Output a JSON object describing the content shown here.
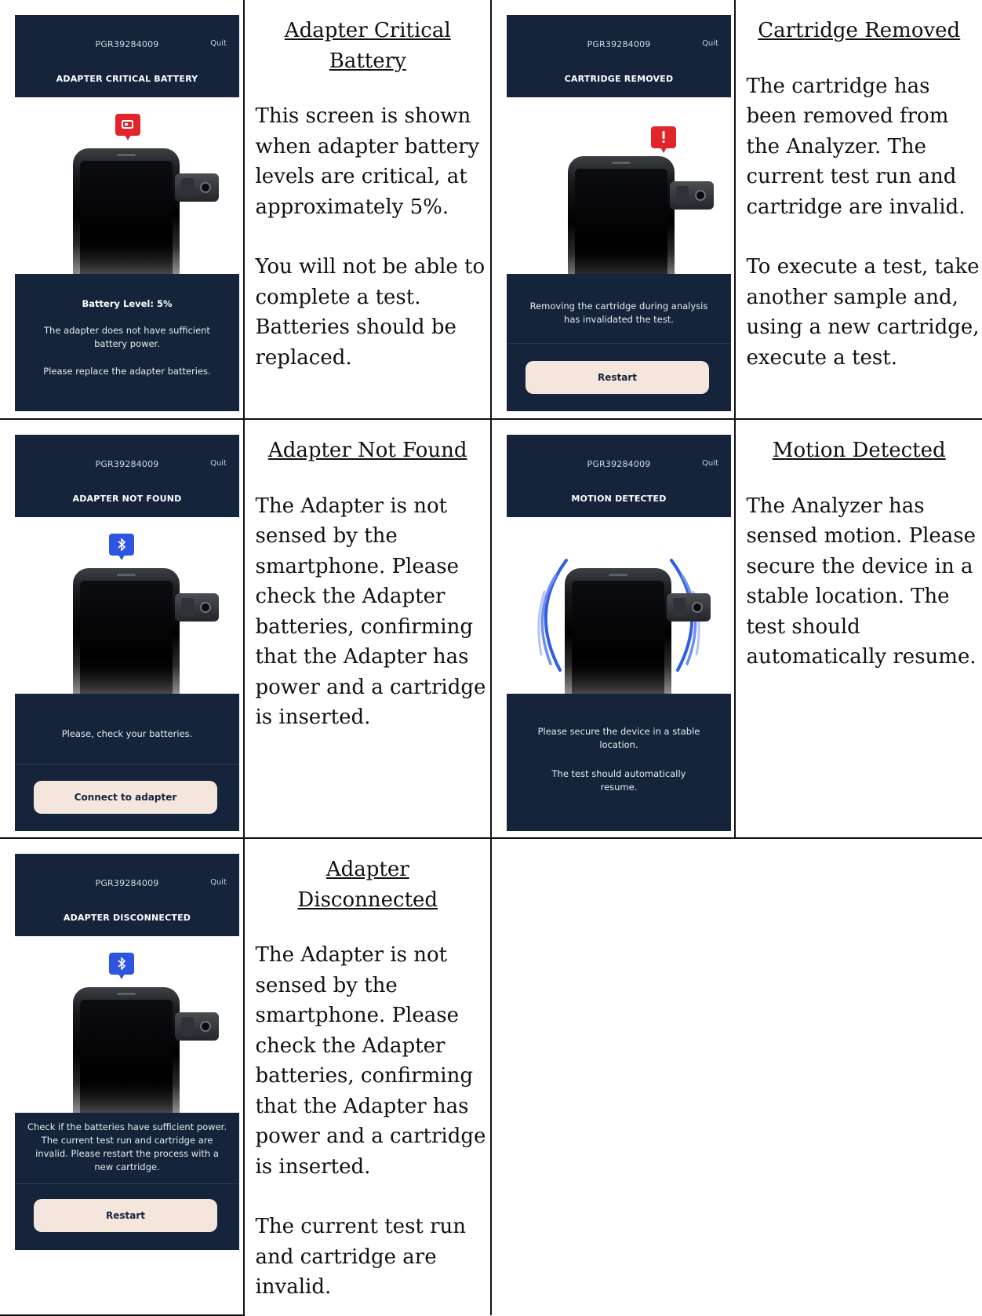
{
  "serial": "PGR39284009",
  "quit_label": "Quit",
  "cells": {
    "critical_battery": {
      "screen_title": "ADAPTER CRITICAL BATTERY",
      "footer_bold": "Battery Level: 5%",
      "footer_line1": "The adapter does not have sufficient battery power.",
      "footer_line2": "Please replace the adapter batteries.",
      "badge_icon": "battery-alert-icon",
      "badge_color": "#e0252d",
      "heading": "Adapter Critical Battery",
      "paragraphs": [
        "This screen is shown when adapter battery levels are critical, at approximately 5%.",
        "You will not be able to complete a test. Batteries should be replaced."
      ]
    },
    "cartridge_removed": {
      "screen_title": "CARTRIDGE REMOVED",
      "footer_line1": "Removing the cartridge during analysis has invalidated the test.",
      "button_label": "Restart",
      "badge_icon": "exclamation-icon",
      "badge_color": "#e0252d",
      "heading": "Cartridge Removed",
      "paragraphs": [
        "The cartridge has been removed from the Analyzer. The current test run and cartridge are invalid.",
        "To execute a test, take another sample and, using a new cartridge, execute a test."
      ]
    },
    "adapter_not_found": {
      "screen_title": "ADAPTER NOT FOUND",
      "footer_line1": "Please, check your batteries.",
      "button_label": "Connect to adapter",
      "badge_icon": "bluetooth-icon",
      "badge_color": "#2e55e0",
      "heading": "Adapter Not Found",
      "paragraphs": [
        "The Adapter is not sensed by the smartphone. Please check the Adapter batteries, confirming that the Adapter has power and a cartridge is inserted."
      ]
    },
    "motion_detected": {
      "screen_title": "MOTION DETECTED",
      "footer_line1": "Please secure the device in a stable location.",
      "footer_line2": "The test should automatically resume.",
      "heading": "Motion Detected",
      "paragraphs": [
        "The Analyzer has sensed motion. Please secure the device in a stable location. The test should automatically resume."
      ]
    },
    "adapter_disconnected": {
      "screen_title": "ADAPTER DISCONNECTED",
      "footer_line1": "Check if the batteries have sufficient power. The current test run and cartridge are invalid. Please restart the process with a new cartridge.",
      "button_label": "Restart",
      "badge_icon": "bluetooth-icon",
      "badge_color": "#2e55e0",
      "heading": "Adapter Disconnected",
      "paragraphs": [
        "The Adapter is not sensed by the smartphone. Please check the Adapter batteries, confirming that the Adapter has power and a cartridge is inserted.",
        "The current test run and cartridge are invalid."
      ]
    }
  }
}
